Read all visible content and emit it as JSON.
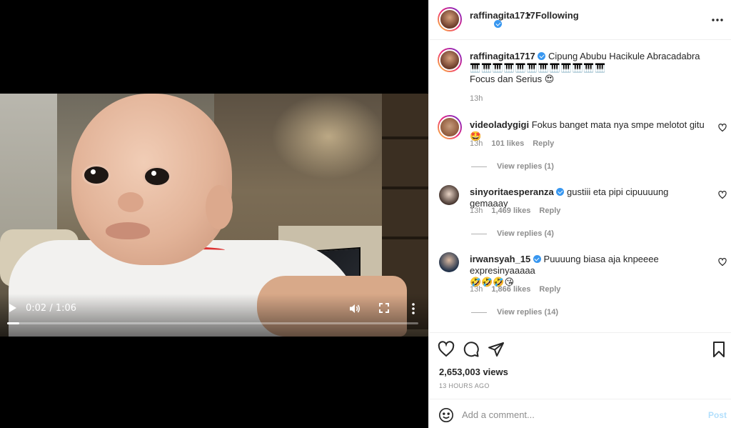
{
  "video": {
    "time_label": "0:02 / 1:06",
    "progress": 0.03
  },
  "header": {
    "username": "raffinagita1717",
    "dot": "•",
    "follow_status": "Following",
    "more_label": "..."
  },
  "caption": {
    "username": "raffinagita1717",
    "line1": "Cipung Abubu Hacikule Abracadabra",
    "line2": "🎹🎹🎹🎹🎹🎹🎹🎹🎹🎹🎹🎹",
    "line3": "Focus dan Serius 😍",
    "time": "13h"
  },
  "comments": [
    {
      "username": "videoladygigi",
      "text": "Fokus banget mata nya smpe melotot gitu🤩",
      "time": "13h",
      "likes": "101 likes",
      "reply_label": "Reply",
      "view_replies": "View replies (1)",
      "verified": false
    },
    {
      "username": "sinyoritaesperanza",
      "text": "gustiii eta pipi cipuuuung gemaaay",
      "time": "13h",
      "likes": "1,469 likes",
      "reply_label": "Reply",
      "view_replies": "View replies (4)",
      "verified": true
    },
    {
      "username": "irwansyah_15",
      "text": "Puuuung biasa aja knpeeee expresinyaaaaa",
      "text2": "🤣🤣🤣😘",
      "time": "13h",
      "likes": "1,866 likes",
      "reply_label": "Reply",
      "view_replies": "View replies (14)",
      "verified": true
    }
  ],
  "actions": {
    "views": "2,653,003 views",
    "time_ago": "13 HOURS AGO"
  },
  "comment_box": {
    "placeholder": "Add a comment...",
    "post_label": "Post"
  },
  "colors": {
    "verified": "#3897f0",
    "post_button": "#b2dffc",
    "muted": "#8e8e8e",
    "text": "#262626"
  },
  "icons": [
    "play-icon",
    "volume-icon",
    "fullscreen-icon",
    "more-vertical-icon",
    "heart-icon",
    "comment-icon",
    "share-icon",
    "bookmark-icon",
    "emoji-icon",
    "verified-icon"
  ]
}
